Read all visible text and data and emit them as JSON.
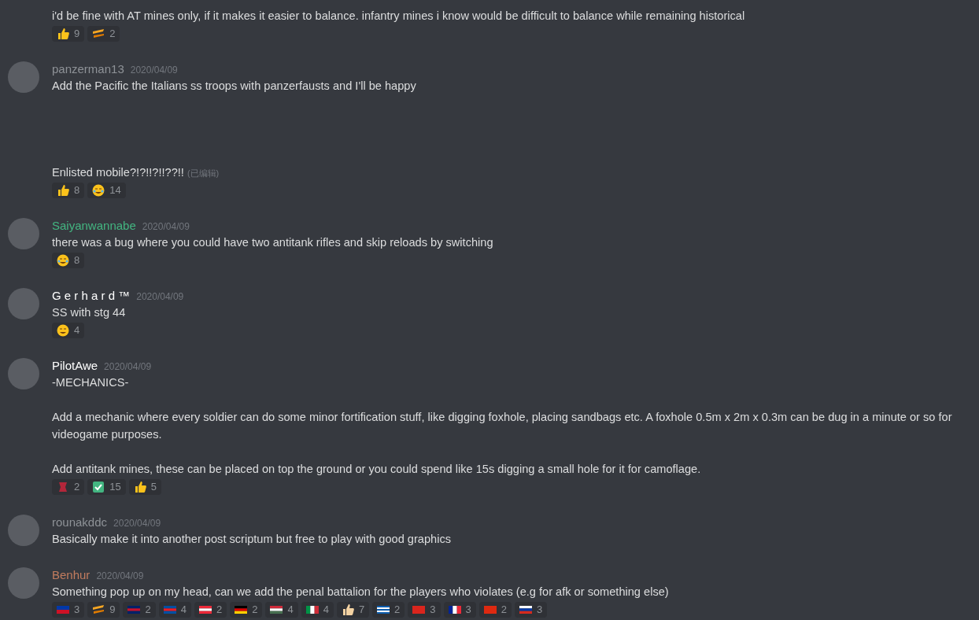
{
  "messages": [
    {
      "lines": [
        {
          "text": "i'd be fine with AT mines only, if it makes it easier to balance. infantry mines i know would be difficult to balance while remaining historical",
          "reactions": [
            {
              "kind": "thumbs-up",
              "count": "9"
            },
            {
              "kind": "yeet",
              "count": "2"
            }
          ]
        }
      ]
    },
    {
      "author": "panzerman13",
      "color": "#8e9297",
      "timestamp": "2020/04/09",
      "lines": [
        {
          "text": "Add the Pacific the Italians ss troops with panzerfausts and I'll be happy"
        },
        {
          "text": "Enlisted mobile?!?!!?!!??!!",
          "edited": "(已编辑)",
          "reactions": [
            {
              "kind": "thumbs-up",
              "count": "8"
            },
            {
              "kind": "crying-laughing",
              "count": "14"
            }
          ]
        }
      ]
    },
    {
      "author": "Saiyanwannabe",
      "color": "#43b581",
      "timestamp": "2020/04/09",
      "lines": [
        {
          "text": "there was a bug where you could have two antitank rifles and skip reloads by switching",
          "reactions": [
            {
              "kind": "rolling-laughing",
              "count": "8"
            }
          ]
        }
      ]
    },
    {
      "author": "G e r h a r d ™",
      "color": "#ffffff",
      "timestamp": "2020/04/09",
      "lines": [
        {
          "text": "SS with stg 44",
          "reactions": [
            {
              "kind": "relieved",
              "count": "4"
            }
          ]
        }
      ]
    },
    {
      "author": "PilotAwe",
      "color": "#ffffff",
      "timestamp": "2020/04/09",
      "lines": [
        {
          "text": "-MECHANICS-\n\nAdd a mechanic where every soldier can do some minor fortification stuff, like digging foxhole, placing sandbags etc. A foxhole 0.5m x 2m x 0.3m can be dug in a minute or so for videogame purposes.\n\nAdd antitank mines, these can be placed on top the ground or you could spend like 15s digging a small hole for it for camoflage.",
          "reactions": [
            {
              "kind": "red-badge",
              "count": "2"
            },
            {
              "kind": "check",
              "count": "15"
            },
            {
              "kind": "thumbs-up",
              "count": "5"
            }
          ]
        }
      ]
    },
    {
      "author": "rounakddc",
      "color": "#8e9297",
      "timestamp": "2020/04/09",
      "lines": [
        {
          "text": "Basically make it into another post scriptum but free to play with good graphics"
        }
      ]
    },
    {
      "author": "Benhur",
      "color": "#c27c5e",
      "timestamp": "2020/04/09",
      "lines": [
        {
          "text": "Something pop up on my head, can we add the penal battalion for the players who violates (e.g for afk or something else)",
          "reactions": [
            {
              "kind": "flag-blue-red",
              "count": "3"
            },
            {
              "kind": "yeet",
              "count": "9"
            },
            {
              "kind": "flag-uk",
              "count": "2"
            },
            {
              "kind": "flag-blue-red-blue",
              "count": "4"
            },
            {
              "kind": "flag-red-white-red",
              "count": "2"
            },
            {
              "kind": "flag-black-red-gold",
              "count": "2"
            },
            {
              "kind": "flag-red-white-green",
              "count": "4"
            },
            {
              "kind": "flag-green-white-red-v",
              "count": "4"
            },
            {
              "kind": "thumbs-up-light",
              "count": "7"
            },
            {
              "kind": "flag-blue-white-stripes",
              "count": "2"
            },
            {
              "kind": "flag-red-star",
              "count": "3"
            },
            {
              "kind": "flag-blue-white-red-v",
              "count": "3"
            },
            {
              "kind": "flag-red-stars",
              "count": "2"
            },
            {
              "kind": "flag-white-blue-red",
              "count": "3"
            }
          ]
        }
      ]
    }
  ]
}
